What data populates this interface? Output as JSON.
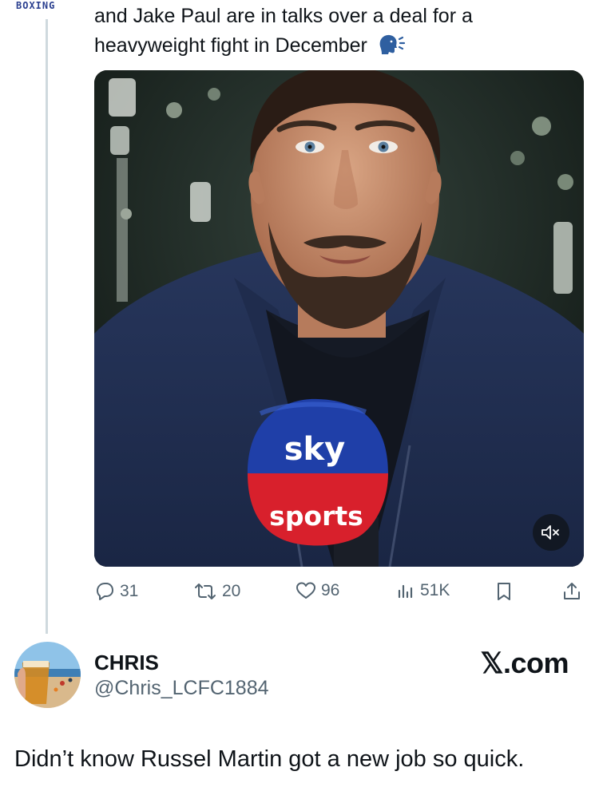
{
  "corner_tag": "BOXING",
  "tweet": {
    "text_line1": "and Jake Paul are in talks over a deal for a",
    "text_line2": "heavyweight fight in December",
    "emoji_icon": "speaking-head-icon"
  },
  "media": {
    "mic_logo_top": "sky",
    "mic_logo_bottom": "sports",
    "mute_icon": "speaker-muted-icon"
  },
  "actions": {
    "replies": "31",
    "reposts": "20",
    "likes": "96",
    "views": "51K"
  },
  "author": {
    "name": "CHRIS",
    "handle": "@Chris_LCFC1884"
  },
  "watermark": "𝕏.com",
  "reply_text": "Didn’t know Russel Martin got a new job so quick.",
  "colors": {
    "text": "#0f1419",
    "muted": "#536471",
    "sky_blue": "#1f3fa8",
    "sky_red": "#d8202c"
  }
}
